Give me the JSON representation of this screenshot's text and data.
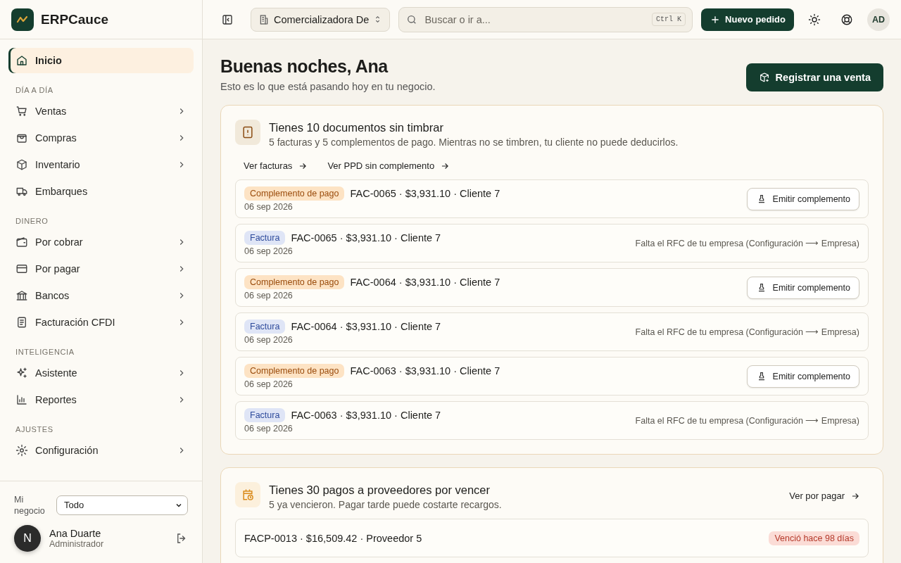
{
  "brand": {
    "name": "ERPCauce"
  },
  "topbar": {
    "company": "Comercializadora De",
    "search_placeholder": "Buscar o ir a...",
    "shortcut": "Ctrl K",
    "new_order": "Nuevo pedido",
    "avatar": "AD"
  },
  "sidebar": {
    "sections": [
      {
        "items": [
          {
            "label": "Inicio",
            "selected": true,
            "expandable": false
          }
        ]
      },
      {
        "heading": "DÍA A DÍA",
        "items": [
          {
            "label": "Ventas",
            "selected": false,
            "expandable": true
          },
          {
            "label": "Compras",
            "selected": false,
            "expandable": true
          },
          {
            "label": "Inventario",
            "selected": false,
            "expandable": true
          },
          {
            "label": "Embarques",
            "selected": false,
            "expandable": false
          }
        ]
      },
      {
        "heading": "DINERO",
        "items": [
          {
            "label": "Por cobrar",
            "selected": false,
            "expandable": true
          },
          {
            "label": "Por pagar",
            "selected": false,
            "expandable": true
          },
          {
            "label": "Bancos",
            "selected": false,
            "expandable": true
          },
          {
            "label": "Facturación CFDI",
            "selected": false,
            "expandable": true
          }
        ]
      },
      {
        "heading": "INTELIGENCIA",
        "items": [
          {
            "label": "Asistente",
            "selected": false,
            "expandable": true
          },
          {
            "label": "Reportes",
            "selected": false,
            "expandable": true
          }
        ]
      },
      {
        "heading": "AJUSTES",
        "items": [
          {
            "label": "Configuración",
            "selected": false,
            "expandable": true
          }
        ]
      }
    ],
    "business_label": "Mi negocio",
    "business_value": "Todo",
    "user": {
      "initial": "N",
      "name": "Ana Duarte",
      "role": "Administrador"
    }
  },
  "main": {
    "greeting": "Buenas noches, Ana",
    "subtitle": "Esto es lo que está pasando hoy en tu negocio.",
    "primary_action": "Registrar una venta",
    "cards": [
      {
        "kind": "warning",
        "title": "Tienes 10 documentos sin timbrar",
        "subtitle": "5 facturas y 5 complementos de pago. Mientras no se timbren, tu cliente no puede deducirlos.",
        "links": [
          "Ver facturas",
          "Ver PPD sin complemento"
        ],
        "rows": [
          {
            "kind": "complemento",
            "tag": "Complemento de pago",
            "title": "FAC-0065 · $3,931.10 · Cliente 7",
            "date": "06 sep 2026",
            "action": "Emitir complemento"
          },
          {
            "kind": "factura",
            "tag": "Factura",
            "title": "FAC-0065 · $3,931.10 · Cliente 7",
            "date": "06 sep 2026",
            "note": "Falta el RFC de tu empresa (Configuración ⟶ Empresa)"
          },
          {
            "kind": "complemento",
            "tag": "Complemento de pago",
            "title": "FAC-0064 · $3,931.10 · Cliente 7",
            "date": "06 sep 2026",
            "action": "Emitir complemento"
          },
          {
            "kind": "factura",
            "tag": "Factura",
            "title": "FAC-0064 · $3,931.10 · Cliente 7",
            "date": "06 sep 2026",
            "note": "Falta el RFC de tu empresa (Configuración ⟶ Empresa)"
          },
          {
            "kind": "complemento",
            "tag": "Complemento de pago",
            "title": "FAC-0063 · $3,931.10 · Cliente 7",
            "date": "06 sep 2026",
            "action": "Emitir complemento"
          },
          {
            "kind": "factura",
            "tag": "Factura",
            "title": "FAC-0063 · $3,931.10 · Cliente 7",
            "date": "06 sep 2026",
            "note": "Falta el RFC de tu empresa (Configuración ⟶ Empresa)"
          }
        ]
      },
      {
        "kind": "calendar",
        "title": "Tienes 30 pagos a proveedores por vencer",
        "subtitle": "5 ya vencieron. Pagar tarde puede costarte recargos.",
        "side_link": "Ver por pagar",
        "rows": [
          {
            "kind": "overdue",
            "title": "FACP-0013 · $16,509.42 · Proveedor 5",
            "tag": "Venció hace 98 días"
          }
        ]
      }
    ]
  }
}
